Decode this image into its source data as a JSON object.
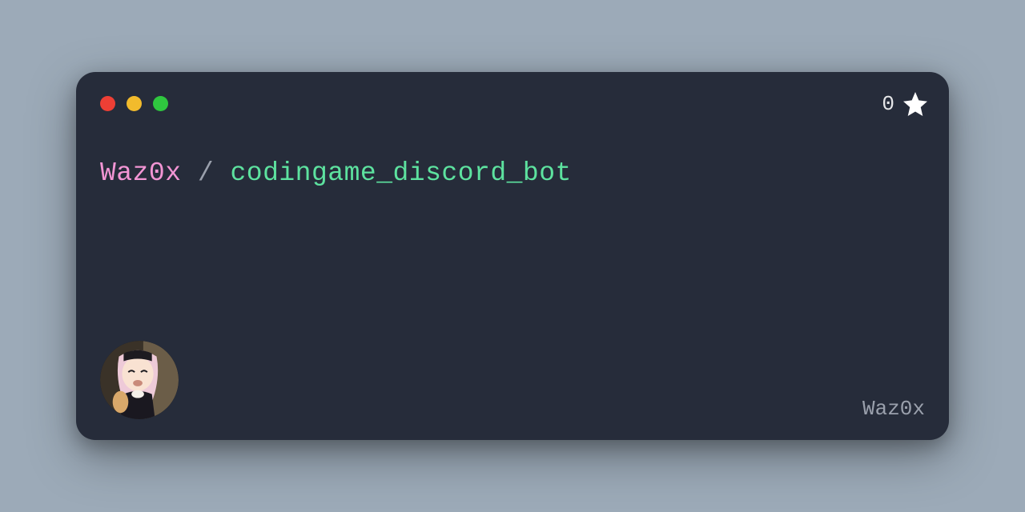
{
  "header": {
    "traffic_lights": {
      "red": "#ed3f35",
      "yellow": "#f2bb2c",
      "green": "#2fc73f"
    },
    "star_count": "0"
  },
  "title": {
    "owner": "Waz0x",
    "separator": "/",
    "repo": "codingame_discord_bot"
  },
  "footer": {
    "username": "Waz0x"
  }
}
